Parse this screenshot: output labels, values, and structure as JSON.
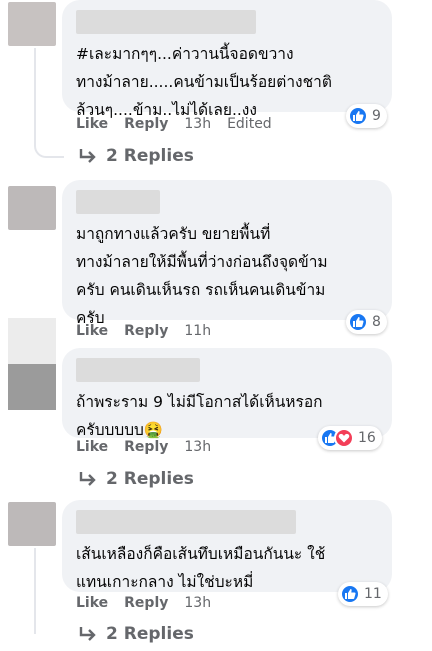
{
  "comments": [
    {
      "text": "#เละมากๆๆ...ค่าวานนี้จอดขวาง\nทางม้าลาย.....คนข้ามเป็นร้อยต่างชาติ\nล้วนๆ....ข้าม..ไม่ได้เลย..งง",
      "like_label": "Like",
      "reply_label": "Reply",
      "time": "13h",
      "edited_label": "Edited",
      "reaction_count": "9",
      "replies_label": "2 Replies"
    },
    {
      "text": "มาถูกทางแล้วครับ ขยายพื้นที่\nทางม้าลายให้มีพื้นที่ว่างก่อนถึงจุดข้าม\nครับ คนเดินเห็นรถ รถเห็นคนเดินข้าม\nครับ",
      "like_label": "Like",
      "reply_label": "Reply",
      "time": "11h",
      "reaction_count": "8"
    },
    {
      "text": "ถ้าพระราม 9 ไม่มีโอกาสได้เห็นหรอก\nครับบบบบ",
      "emoji": "🤮",
      "like_label": "Like",
      "reply_label": "Reply",
      "time": "13h",
      "reaction_count": "16",
      "replies_label": "2 Replies"
    },
    {
      "text": "เส้นเหลืองก็คือเส้นทึบเหมือนกันนะ ใช้\nแทนเกาะกลาง ไม่ใช่บะหมี่",
      "like_label": "Like",
      "reply_label": "Reply",
      "time": "13h",
      "reaction_count": "11",
      "replies_label": "2 Replies"
    }
  ],
  "colors": {
    "bubble": "#f0f2f5",
    "meta": "#65676b",
    "like_blue": "#1877f2",
    "love_red": "#f33e58"
  },
  "icons": [
    "thumbs-up-icon",
    "heart-icon",
    "reply-arrow-icon",
    "nauseated-face-emoji"
  ]
}
